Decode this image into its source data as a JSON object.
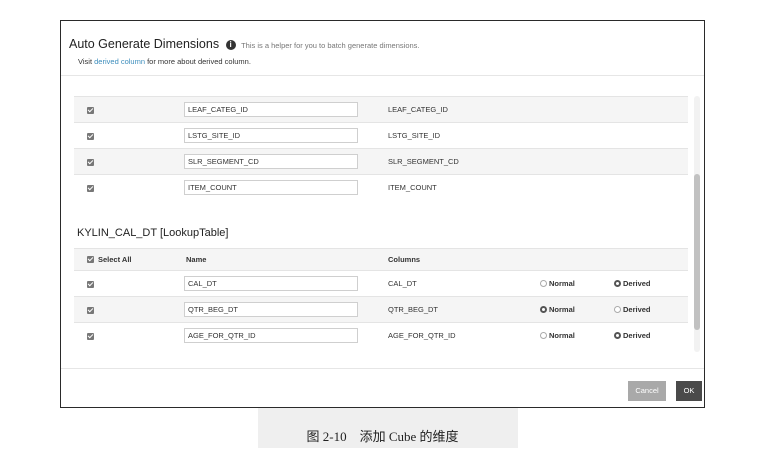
{
  "dialog": {
    "title": "Auto Generate Dimensions",
    "helper": "This is a helper for you to batch generate dimensions.",
    "subtitle_prefix": "Visit",
    "subtitle_link": "derived column",
    "subtitle_suffix": "for more about derived column."
  },
  "fact_rows": [
    {
      "name": "LEAF_CATEG_ID",
      "column": "LEAF_CATEG_ID"
    },
    {
      "name": "LSTG_SITE_ID",
      "column": "LSTG_SITE_ID"
    },
    {
      "name": "SLR_SEGMENT_CD",
      "column": "SLR_SEGMENT_CD"
    },
    {
      "name": "ITEM_COUNT",
      "column": "ITEM_COUNT"
    }
  ],
  "lookup_table": {
    "title": "KYLIN_CAL_DT [LookupTable]",
    "headers": {
      "select_all": "Select All",
      "name": "Name",
      "columns": "Columns"
    },
    "normal_label": "Normal",
    "derived_label": "Derived",
    "rows": [
      {
        "name": "CAL_DT",
        "column": "CAL_DT",
        "selected": "Derived"
      },
      {
        "name": "QTR_BEG_DT",
        "column": "QTR_BEG_DT",
        "selected": "Normal"
      },
      {
        "name": "AGE_FOR_QTR_ID",
        "column": "AGE_FOR_QTR_ID",
        "selected": "Derived"
      }
    ]
  },
  "footer": {
    "cancel": "Cancel",
    "ok": "OK"
  },
  "caption": "图 2-10　添加 Cube 的维度"
}
